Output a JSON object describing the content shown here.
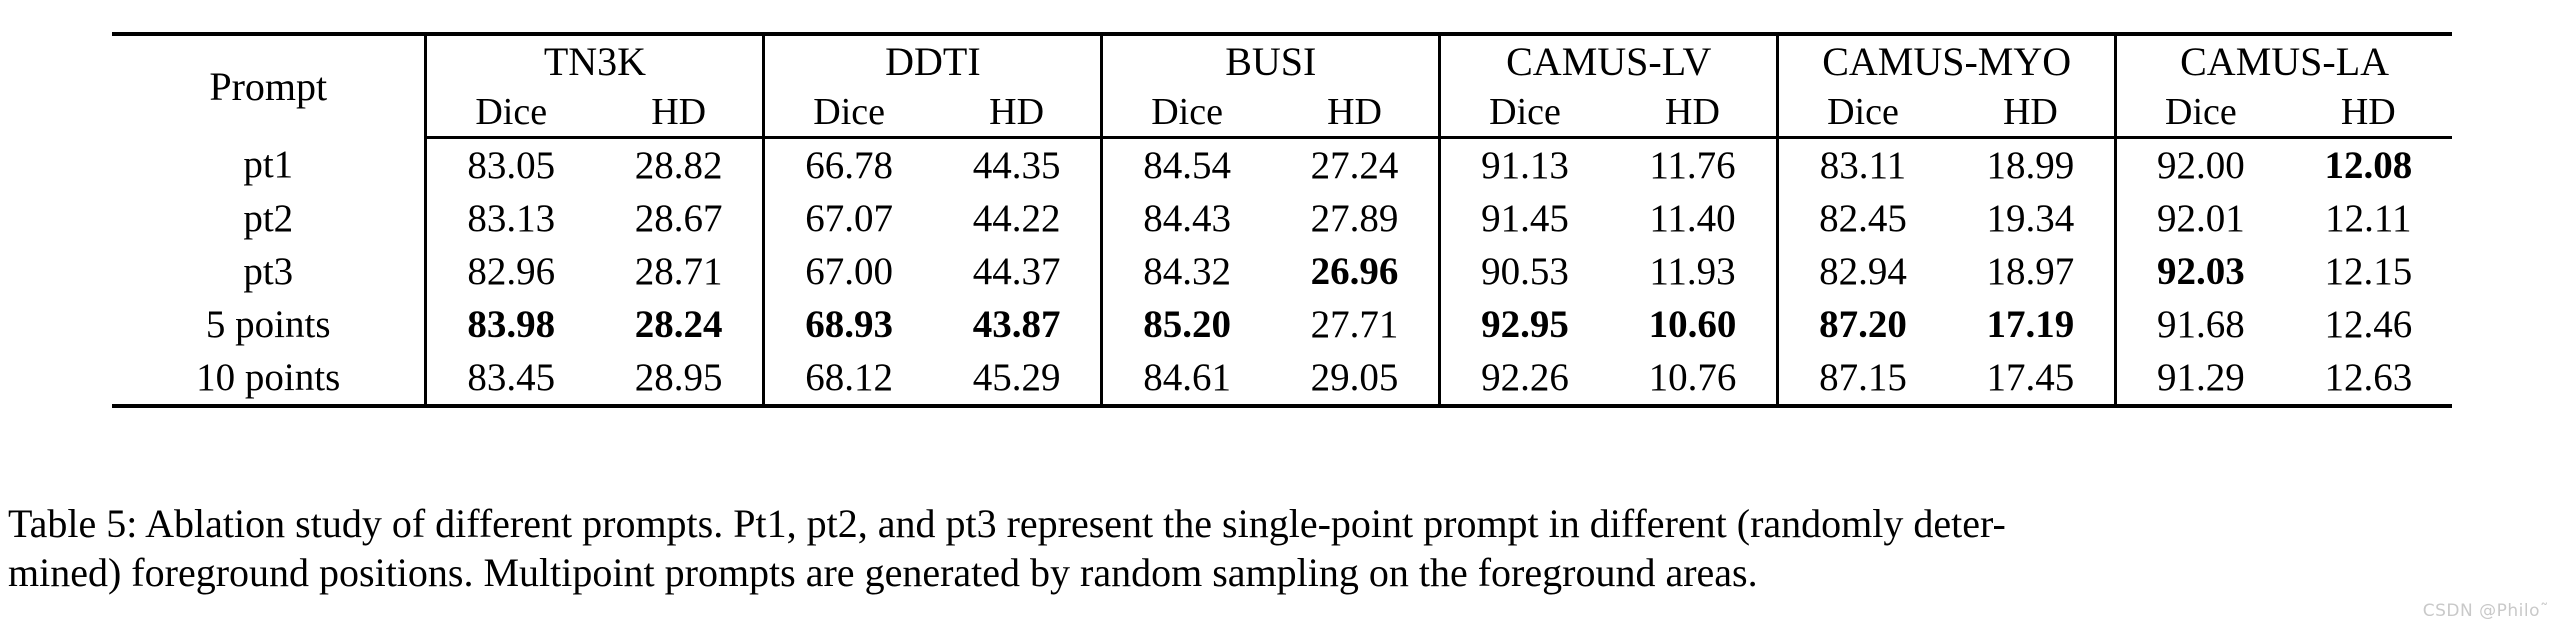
{
  "table": {
    "prompt_header": "Prompt",
    "datasets": [
      {
        "name": "TN3K",
        "metrics": [
          "Dice",
          "HD"
        ]
      },
      {
        "name": "DDTI",
        "metrics": [
          "Dice",
          "HD"
        ]
      },
      {
        "name": "BUSI",
        "metrics": [
          "Dice",
          "HD"
        ]
      },
      {
        "name": "CAMUS-LV",
        "metrics": [
          "Dice",
          "HD"
        ]
      },
      {
        "name": "CAMUS-MYO",
        "metrics": [
          "Dice",
          "HD"
        ]
      },
      {
        "name": "CAMUS-LA",
        "metrics": [
          "Dice",
          "HD"
        ]
      }
    ],
    "rows": [
      {
        "label": "pt1",
        "label_bold": false,
        "cells": [
          {
            "v": "83.05",
            "b": false
          },
          {
            "v": "28.82",
            "b": false
          },
          {
            "v": "66.78",
            "b": false
          },
          {
            "v": "44.35",
            "b": false
          },
          {
            "v": "84.54",
            "b": false
          },
          {
            "v": "27.24",
            "b": false
          },
          {
            "v": "91.13",
            "b": false
          },
          {
            "v": "11.76",
            "b": false
          },
          {
            "v": "83.11",
            "b": false
          },
          {
            "v": "18.99",
            "b": false
          },
          {
            "v": "92.00",
            "b": false
          },
          {
            "v": "12.08",
            "b": true
          }
        ]
      },
      {
        "label": "pt2",
        "label_bold": false,
        "cells": [
          {
            "v": "83.13",
            "b": false
          },
          {
            "v": "28.67",
            "b": false
          },
          {
            "v": "67.07",
            "b": false
          },
          {
            "v": "44.22",
            "b": false
          },
          {
            "v": "84.43",
            "b": false
          },
          {
            "v": "27.89",
            "b": false
          },
          {
            "v": "91.45",
            "b": false
          },
          {
            "v": "11.40",
            "b": false
          },
          {
            "v": "82.45",
            "b": false
          },
          {
            "v": "19.34",
            "b": false
          },
          {
            "v": "92.01",
            "b": false
          },
          {
            "v": "12.11",
            "b": false
          }
        ]
      },
      {
        "label": "pt3",
        "label_bold": false,
        "cells": [
          {
            "v": "82.96",
            "b": false
          },
          {
            "v": "28.71",
            "b": false
          },
          {
            "v": "67.00",
            "b": false
          },
          {
            "v": "44.37",
            "b": false
          },
          {
            "v": "84.32",
            "b": false
          },
          {
            "v": "26.96",
            "b": true
          },
          {
            "v": "90.53",
            "b": false
          },
          {
            "v": "11.93",
            "b": false
          },
          {
            "v": "82.94",
            "b": false
          },
          {
            "v": "18.97",
            "b": false
          },
          {
            "v": "92.03",
            "b": true
          },
          {
            "v": "12.15",
            "b": false
          }
        ]
      },
      {
        "label": "5 points",
        "label_bold": false,
        "cells": [
          {
            "v": "83.98",
            "b": true
          },
          {
            "v": "28.24",
            "b": true
          },
          {
            "v": "68.93",
            "b": true
          },
          {
            "v": "43.87",
            "b": true
          },
          {
            "v": "85.20",
            "b": true
          },
          {
            "v": "27.71",
            "b": false
          },
          {
            "v": "92.95",
            "b": true
          },
          {
            "v": "10.60",
            "b": true
          },
          {
            "v": "87.20",
            "b": true
          },
          {
            "v": "17.19",
            "b": true
          },
          {
            "v": "91.68",
            "b": false
          },
          {
            "v": "12.46",
            "b": false
          }
        ]
      },
      {
        "label": "10 points",
        "label_bold": false,
        "cells": [
          {
            "v": "83.45",
            "b": false
          },
          {
            "v": "28.95",
            "b": false
          },
          {
            "v": "68.12",
            "b": false
          },
          {
            "v": "45.29",
            "b": false
          },
          {
            "v": "84.61",
            "b": false
          },
          {
            "v": "29.05",
            "b": false
          },
          {
            "v": "92.26",
            "b": false
          },
          {
            "v": "10.76",
            "b": false
          },
          {
            "v": "87.15",
            "b": false
          },
          {
            "v": "17.45",
            "b": false
          },
          {
            "v": "91.29",
            "b": false
          },
          {
            "v": "12.63",
            "b": false
          }
        ]
      }
    ]
  },
  "caption": {
    "line1": "Table 5: Ablation study of different prompts. Pt1, pt2, and pt3 represent the single-point prompt in different (randomly deter-",
    "line2": "mined) foreground positions. Multipoint prompts are generated by random sampling on the foreground areas."
  },
  "watermark": {
    "text": "CSDN @Philo˜"
  }
}
